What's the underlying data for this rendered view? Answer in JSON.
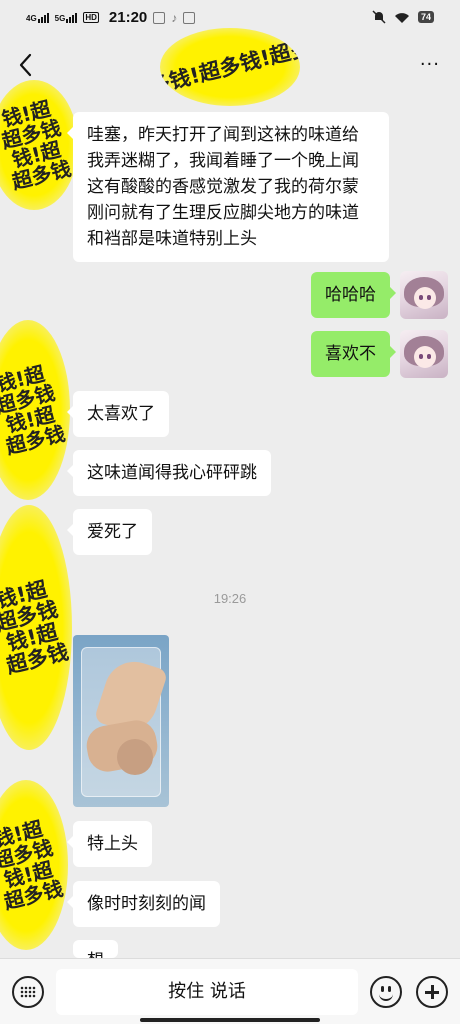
{
  "status_bar": {
    "signal_1": "4G",
    "signal_2": "5G",
    "hd": "HD",
    "time": "21:20",
    "battery": "74"
  },
  "nav": {
    "back_icon": "chevron-left-icon",
    "more_icon": "more-dots-icon",
    "more_label": "···",
    "title_sticker": "超多钱!超多钱!超多钱"
  },
  "stickers": {
    "sticker_text": "钱!超\n超多钱\n钱!超\n超多钱"
  },
  "messages": [
    {
      "side": "left",
      "text": "哇塞，昨天打开了闻到这袜的味道给我弄迷糊了，我闻着睡了一个晚上闻这有酸酸的香感觉激发了我的荷尔蒙刚问就有了生理反应脚尖地方的味道和裆部是味道特别上头"
    },
    {
      "side": "right",
      "text": "哈哈哈"
    },
    {
      "side": "right",
      "text": "喜欢不"
    },
    {
      "side": "left",
      "text": "太喜欢了"
    },
    {
      "side": "left",
      "text": "这味道闻得我心砰砰跳"
    },
    {
      "side": "left",
      "text": "爱死了"
    },
    {
      "side": "left",
      "text": "特上头"
    },
    {
      "side": "left",
      "text": "像时时刻刻的闻"
    },
    {
      "side": "left",
      "text": "想"
    }
  ],
  "timestamp": "19:26",
  "bottom_bar": {
    "hold_to_talk": "按住 说话",
    "keyboard_icon": "keyboard-icon",
    "emoji_icon": "emoji-icon",
    "plus_icon": "plus-icon"
  },
  "colors": {
    "background": "#ededed",
    "sent_bubble": "#95ec69",
    "received_bubble": "#ffffff",
    "sticker_yellow": "#fff200"
  }
}
